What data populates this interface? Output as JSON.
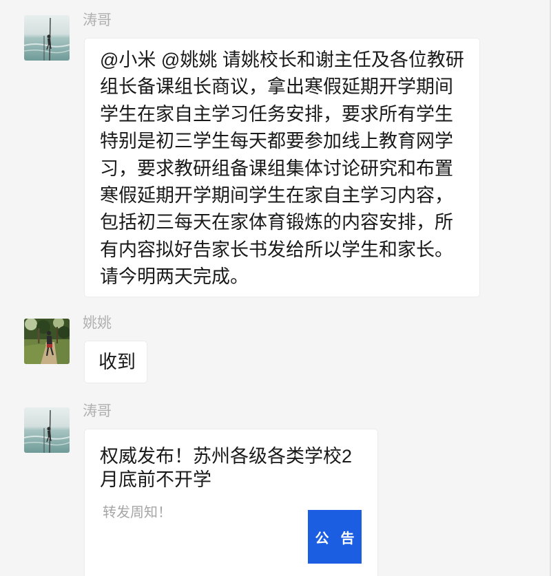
{
  "colors": {
    "background": "#f5f5f5",
    "bubble": "#ffffff",
    "sender_name": "#b0b0b0",
    "text": "#191919",
    "card_thumbnail": "#1b5ee2",
    "card_description": "#a6a6a6"
  },
  "chat": {
    "messages": [
      {
        "sender": "涛哥",
        "avatar_icon": "sea-pole-avatar",
        "lines": [
          "@小米 @姚姚 请姚校长和谢主任及各位教研",
          "组长备课组长商议，拿出寒假延期开学期间",
          "学生在家自主学习任务安排，要求所有学生",
          "特别是初三学生每天都要参加线上教育网学",
          "习，要求教研组备课组集体讨论研究和布置",
          "寒假延期开学期间学生在家自主学习内容，",
          "包括初三每天在家体育锻炼的内容安排，所",
          "有内容拟好告家长书发给所以学生和家长。",
          "请今明两天完成。"
        ]
      },
      {
        "sender": "姚姚",
        "avatar_icon": "park-runner-avatar",
        "lines": [
          "收到"
        ]
      },
      {
        "sender": "涛哥",
        "avatar_icon": "sea-pole-avatar",
        "card": {
          "title_lines": [
            "权威发布！苏州各级各类学校2",
            "月底前不开学"
          ],
          "description": "转发周知！",
          "thumbnail_text": "公 告"
        }
      }
    ]
  }
}
